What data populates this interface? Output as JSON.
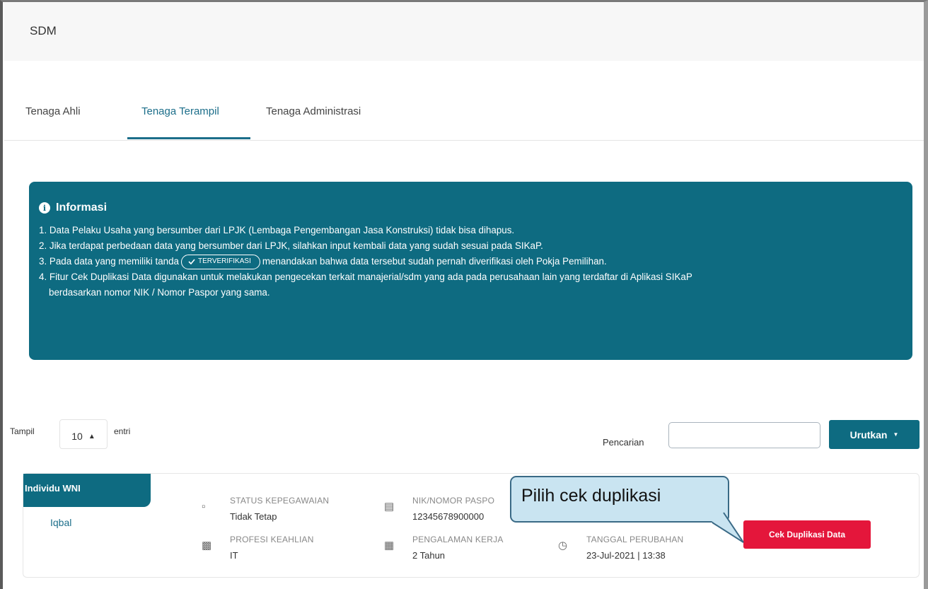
{
  "header": {
    "title": "SDM"
  },
  "tabs": [
    {
      "label": "Tenaga Ahli"
    },
    {
      "label": "Tenaga Terampil",
      "active": true
    },
    {
      "label": "Tenaga Administrasi"
    }
  ],
  "info": {
    "title": "Informasi",
    "item1": "1. Data Pelaku Usaha yang bersumber dari LPJK (Lembaga Pengembangan Jasa Konstruksi) tidak bisa dihapus.",
    "item2": "2. Jika terdapat perbedaan data yang bersumber dari LPJK, silahkan input kembali data yang sudah sesuai pada SIKaP.",
    "item3_pre": "3. Pada data yang memiliki tanda",
    "item3_badge": "TERVERIFIKASI",
    "item3_post": "menandakan bahwa data tersebut sudah pernah diverifikasi oleh Pokja Pemilihan.",
    "item4_line1": "4. Fitur Cek Duplikasi Data digunakan untuk melakukan pengecekan terkait manajerial/sdm yang ada pada perusahaan lain yang terdaftar di Aplikasi SIKaP",
    "item4_line2": "berdasarkan nomor NIK / Nomor Paspor yang sama."
  },
  "toolbar": {
    "show_label": "Tampil",
    "entries_value": "10",
    "entries_suffix": "entri",
    "search_label": "Pencarian",
    "search_value": "",
    "sort_label": "Urutkan"
  },
  "card": {
    "tag": "Individu WNI",
    "name": "Iqbal",
    "status_label": "STATUS KEPEGAWAIAN",
    "status_value": "Tidak Tetap",
    "nik_label": "NIK/NOMOR PASPO",
    "nik_value": "12345678900000",
    "profesi_label": "PROFESI KEAHLIAN",
    "profesi_value": "IT",
    "pengalaman_label": "PENGALAMAN KERJA",
    "pengalaman_value": "2 Tahun",
    "tanggal_label": "TANGGAL PERUBAHAN",
    "tanggal_value": "23-Jul-2021 | 13:38",
    "check_button": "Cek Duplikasi Data"
  },
  "callout": {
    "text": "Pilih cek duplikasi"
  },
  "colors": {
    "primary": "#0e6b81",
    "danger": "#e4163b",
    "callout_bg": "#c9e4f1"
  }
}
